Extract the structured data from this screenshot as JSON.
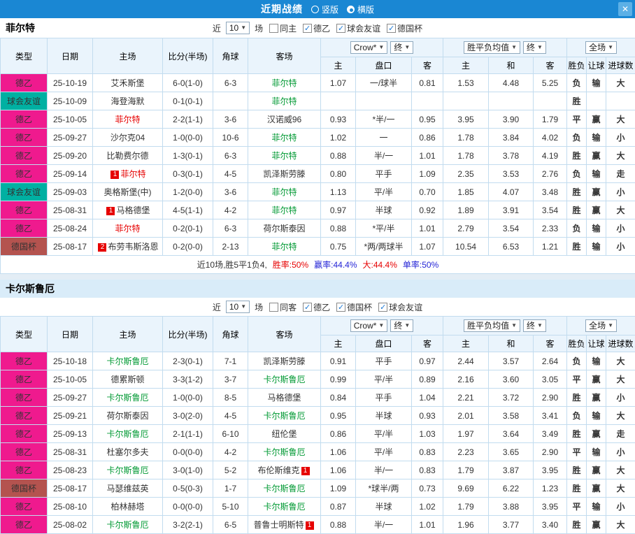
{
  "titlebar": {
    "title": "近期战绩",
    "layout_options": [
      {
        "label": "竖版",
        "selected": false
      },
      {
        "label": "横版",
        "selected": true
      }
    ],
    "close_icon": "✕"
  },
  "table_header": {
    "fixed_columns": [
      "类型",
      "日期",
      "主场",
      "比分(半场)",
      "角球",
      "客场"
    ],
    "odds_dropdowns": [
      "Crow*",
      "终"
    ],
    "avg_dropdowns": [
      "胜平负均值",
      "终"
    ],
    "scope_dropdown": "全场",
    "sub_columns": [
      "主",
      "盘口",
      "客",
      "主",
      "和",
      "客",
      "胜负",
      "让球",
      "进球数"
    ]
  },
  "colors": {
    "accent": "#1a87d3",
    "type_德乙": "#ef1a8e",
    "type_球会友谊": "#00b0a2",
    "type_德国杯": "#b4534f",
    "red": "#e60000",
    "green": "#009933",
    "blue": "#2424d6"
  },
  "sections": [
    {
      "team": "菲尔特",
      "head_style": "inline",
      "filter": {
        "prefix": "近",
        "count": "10",
        "suffix": "场",
        "checkboxes": [
          {
            "label": "同主",
            "checked": false
          },
          {
            "label": "德乙",
            "checked": true
          },
          {
            "label": "球会友谊",
            "checked": true
          },
          {
            "label": "德国杯",
            "checked": true
          }
        ]
      },
      "rows": [
        {
          "type": "德乙",
          "date": "25-10-19",
          "home": {
            "name": "艾禾斯堡",
            "color": "black"
          },
          "score": "6-0(1-0)",
          "corners": "6-3",
          "away": {
            "name": "菲尔特",
            "color": "green"
          },
          "odds": [
            "1.07",
            "一/球半",
            "0.81"
          ],
          "avg": [
            "1.53",
            "4.48",
            "5.25"
          ],
          "result": {
            "text": "负",
            "color": "green"
          },
          "handicap_result": {
            "text": "输",
            "color": "green"
          },
          "goals": {
            "text": "大",
            "color": "red"
          }
        },
        {
          "type": "球会友谊",
          "date": "25-10-09",
          "home": {
            "name": "海登海默",
            "color": "black"
          },
          "score": "0-1(0-1)",
          "corners": "",
          "away": {
            "name": "菲尔特",
            "color": "green"
          },
          "odds": [
            "",
            "",
            ""
          ],
          "avg": [
            "",
            "",
            ""
          ],
          "result": {
            "text": "胜",
            "color": "red"
          },
          "handicap_result": {
            "text": "",
            "color": "black"
          },
          "goals": {
            "text": "",
            "color": "black"
          }
        },
        {
          "type": "德乙",
          "date": "25-10-05",
          "home": {
            "name": "菲尔特",
            "color": "red"
          },
          "score": "2-2(1-1)",
          "corners": "3-6",
          "away": {
            "name": "汉诺威96",
            "color": "black"
          },
          "odds": [
            "0.93",
            "*半/一",
            "0.95"
          ],
          "avg": [
            "3.95",
            "3.90",
            "1.79"
          ],
          "result": {
            "text": "平",
            "color": "blue"
          },
          "handicap_result": {
            "text": "赢",
            "color": "red"
          },
          "goals": {
            "text": "大",
            "color": "red"
          }
        },
        {
          "type": "德乙",
          "date": "25-09-27",
          "home": {
            "name": "沙尔克04",
            "color": "black"
          },
          "score": "1-0(0-0)",
          "corners": "10-6",
          "away": {
            "name": "菲尔特",
            "color": "green"
          },
          "odds": [
            "1.02",
            "一",
            "0.86"
          ],
          "avg": [
            "1.78",
            "3.84",
            "4.02"
          ],
          "result": {
            "text": "负",
            "color": "green"
          },
          "handicap_result": {
            "text": "输",
            "color": "green"
          },
          "goals": {
            "text": "小",
            "color": "green"
          }
        },
        {
          "type": "德乙",
          "date": "25-09-20",
          "home": {
            "name": "比勒费尔德",
            "color": "black"
          },
          "score": "1-3(0-1)",
          "corners": "6-3",
          "away": {
            "name": "菲尔特",
            "color": "green"
          },
          "odds": [
            "0.88",
            "半/一",
            "1.01"
          ],
          "avg": [
            "1.78",
            "3.78",
            "4.19"
          ],
          "result": {
            "text": "胜",
            "color": "red"
          },
          "handicap_result": {
            "text": "赢",
            "color": "red"
          },
          "goals": {
            "text": "大",
            "color": "red"
          }
        },
        {
          "type": "德乙",
          "date": "25-09-14",
          "home": {
            "name": "菲尔特",
            "color": "red",
            "badge": "1",
            "badge_pos": "before"
          },
          "score": "0-3(0-1)",
          "corners": "4-5",
          "away": {
            "name": "凯泽斯劳滕",
            "color": "black"
          },
          "odds": [
            "0.80",
            "平手",
            "1.09"
          ],
          "avg": [
            "2.35",
            "3.53",
            "2.76"
          ],
          "result": {
            "text": "负",
            "color": "green"
          },
          "handicap_result": {
            "text": "输",
            "color": "green"
          },
          "goals": {
            "text": "走",
            "color": "blue"
          }
        },
        {
          "type": "球会友谊",
          "date": "25-09-03",
          "home": {
            "name": "奥格斯堡(中)",
            "color": "black"
          },
          "score": "1-2(0-0)",
          "corners": "3-6",
          "away": {
            "name": "菲尔特",
            "color": "green"
          },
          "odds": [
            "1.13",
            "平/半",
            "0.70"
          ],
          "avg": [
            "1.85",
            "4.07",
            "3.48"
          ],
          "result": {
            "text": "胜",
            "color": "red"
          },
          "handicap_result": {
            "text": "赢",
            "color": "red"
          },
          "goals": {
            "text": "小",
            "color": "green"
          }
        },
        {
          "type": "德乙",
          "date": "25-08-31",
          "home": {
            "name": "马格德堡",
            "color": "black",
            "badge": "1",
            "badge_pos": "before"
          },
          "score": "4-5(1-1)",
          "corners": "4-2",
          "away": {
            "name": "菲尔特",
            "color": "green"
          },
          "odds": [
            "0.97",
            "半球",
            "0.92"
          ],
          "avg": [
            "1.89",
            "3.91",
            "3.54"
          ],
          "result": {
            "text": "胜",
            "color": "red"
          },
          "handicap_result": {
            "text": "赢",
            "color": "red"
          },
          "goals": {
            "text": "大",
            "color": "red"
          }
        },
        {
          "type": "德乙",
          "date": "25-08-24",
          "home": {
            "name": "菲尔特",
            "color": "red"
          },
          "score": "0-2(0-1)",
          "corners": "6-3",
          "away": {
            "name": "荷尔斯泰因",
            "color": "black"
          },
          "odds": [
            "0.88",
            "*平/半",
            "1.01"
          ],
          "avg": [
            "2.79",
            "3.54",
            "2.33"
          ],
          "result": {
            "text": "负",
            "color": "green"
          },
          "handicap_result": {
            "text": "输",
            "color": "green"
          },
          "goals": {
            "text": "小",
            "color": "green"
          }
        },
        {
          "type": "德国杯",
          "date": "25-08-17",
          "home": {
            "name": "布劳韦斯洛恩",
            "color": "black",
            "badge": "2",
            "badge_pos": "before"
          },
          "score": "0-2(0-0)",
          "corners": "2-13",
          "away": {
            "name": "菲尔特",
            "color": "green"
          },
          "odds": [
            "0.75",
            "*两/两球半",
            "1.07"
          ],
          "avg": [
            "10.54",
            "6.53",
            "1.21"
          ],
          "result": {
            "text": "胜",
            "color": "red"
          },
          "handicap_result": {
            "text": "输",
            "color": "green"
          },
          "goals": {
            "text": "小",
            "color": "green"
          }
        }
      ],
      "summary": [
        {
          "text": "近10场,胜5平1负4,",
          "color": "black"
        },
        {
          "text": "胜率:50%",
          "color": "red"
        },
        {
          "text": "赢率:44.4%",
          "color": "blue"
        },
        {
          "text": "大:44.4%",
          "color": "red"
        },
        {
          "text": "单率:50%",
          "color": "blue"
        }
      ]
    },
    {
      "team": "卡尔斯鲁厄",
      "head_style": "stacked",
      "filter": {
        "prefix": "近",
        "count": "10",
        "suffix": "场",
        "checkboxes": [
          {
            "label": "同客",
            "checked": false
          },
          {
            "label": "德乙",
            "checked": true
          },
          {
            "label": "德国杯",
            "checked": true
          },
          {
            "label": "球会友谊",
            "checked": true
          }
        ]
      },
      "rows": [
        {
          "type": "德乙",
          "date": "25-10-18",
          "home": {
            "name": "卡尔斯鲁厄",
            "color": "green"
          },
          "score": "2-3(0-1)",
          "corners": "7-1",
          "away": {
            "name": "凯泽斯劳滕",
            "color": "black"
          },
          "odds": [
            "0.91",
            "平手",
            "0.97"
          ],
          "avg": [
            "2.44",
            "3.57",
            "2.64"
          ],
          "result": {
            "text": "负",
            "color": "green"
          },
          "handicap_result": {
            "text": "输",
            "color": "green"
          },
          "goals": {
            "text": "大",
            "color": "red"
          }
        },
        {
          "type": "德乙",
          "date": "25-10-05",
          "home": {
            "name": "德累斯顿",
            "color": "black"
          },
          "score": "3-3(1-2)",
          "corners": "3-7",
          "away": {
            "name": "卡尔斯鲁厄",
            "color": "green"
          },
          "odds": [
            "0.99",
            "平/半",
            "0.89"
          ],
          "avg": [
            "2.16",
            "3.60",
            "3.05"
          ],
          "result": {
            "text": "平",
            "color": "blue"
          },
          "handicap_result": {
            "text": "赢",
            "color": "red"
          },
          "goals": {
            "text": "大",
            "color": "red"
          }
        },
        {
          "type": "德乙",
          "date": "25-09-27",
          "home": {
            "name": "卡尔斯鲁厄",
            "color": "green"
          },
          "score": "1-0(0-0)",
          "corners": "8-5",
          "away": {
            "name": "马格德堡",
            "color": "black"
          },
          "odds": [
            "0.84",
            "平手",
            "1.04"
          ],
          "avg": [
            "2.21",
            "3.72",
            "2.90"
          ],
          "result": {
            "text": "胜",
            "color": "red"
          },
          "handicap_result": {
            "text": "赢",
            "color": "red"
          },
          "goals": {
            "text": "小",
            "color": "green"
          }
        },
        {
          "type": "德乙",
          "date": "25-09-21",
          "home": {
            "name": "荷尔斯泰因",
            "color": "black"
          },
          "score": "3-0(2-0)",
          "corners": "4-5",
          "away": {
            "name": "卡尔斯鲁厄",
            "color": "green"
          },
          "odds": [
            "0.95",
            "半球",
            "0.93"
          ],
          "avg": [
            "2.01",
            "3.58",
            "3.41"
          ],
          "result": {
            "text": "负",
            "color": "green"
          },
          "handicap_result": {
            "text": "输",
            "color": "green"
          },
          "goals": {
            "text": "大",
            "color": "red"
          }
        },
        {
          "type": "德乙",
          "date": "25-09-13",
          "home": {
            "name": "卡尔斯鲁厄",
            "color": "green"
          },
          "score": "2-1(1-1)",
          "corners": "6-10",
          "away": {
            "name": "纽伦堡",
            "color": "black"
          },
          "odds": [
            "0.86",
            "平/半",
            "1.03"
          ],
          "avg": [
            "1.97",
            "3.64",
            "3.49"
          ],
          "result": {
            "text": "胜",
            "color": "red"
          },
          "handicap_result": {
            "text": "赢",
            "color": "red"
          },
          "goals": {
            "text": "走",
            "color": "blue"
          }
        },
        {
          "type": "德乙",
          "date": "25-08-31",
          "home": {
            "name": "杜塞尔多夫",
            "color": "black"
          },
          "score": "0-0(0-0)",
          "corners": "4-2",
          "away": {
            "name": "卡尔斯鲁厄",
            "color": "green"
          },
          "odds": [
            "1.06",
            "平/半",
            "0.83"
          ],
          "avg": [
            "2.23",
            "3.65",
            "2.90"
          ],
          "result": {
            "text": "平",
            "color": "blue"
          },
          "handicap_result": {
            "text": "输",
            "color": "green"
          },
          "goals": {
            "text": "小",
            "color": "green"
          }
        },
        {
          "type": "德乙",
          "date": "25-08-23",
          "home": {
            "name": "卡尔斯鲁厄",
            "color": "green"
          },
          "score": "3-0(1-0)",
          "corners": "5-2",
          "away": {
            "name": "布伦斯维克",
            "color": "black",
            "badge": "1",
            "badge_pos": "after"
          },
          "odds": [
            "1.06",
            "半/一",
            "0.83"
          ],
          "avg": [
            "1.79",
            "3.87",
            "3.95"
          ],
          "result": {
            "text": "胜",
            "color": "red"
          },
          "handicap_result": {
            "text": "赢",
            "color": "red"
          },
          "goals": {
            "text": "大",
            "color": "red"
          }
        },
        {
          "type": "德国杯",
          "date": "25-08-17",
          "home": {
            "name": "马瑟维兹英",
            "color": "black"
          },
          "score": "0-5(0-3)",
          "corners": "1-7",
          "away": {
            "name": "卡尔斯鲁厄",
            "color": "green"
          },
          "odds": [
            "1.09",
            "*球半/两",
            "0.73"
          ],
          "avg": [
            "9.69",
            "6.22",
            "1.23"
          ],
          "result": {
            "text": "胜",
            "color": "red"
          },
          "handicap_result": {
            "text": "赢",
            "color": "red"
          },
          "goals": {
            "text": "大",
            "color": "red"
          }
        },
        {
          "type": "德乙",
          "date": "25-08-10",
          "home": {
            "name": "柏林赫塔",
            "color": "black"
          },
          "score": "0-0(0-0)",
          "corners": "5-10",
          "away": {
            "name": "卡尔斯鲁厄",
            "color": "green"
          },
          "odds": [
            "0.87",
            "半球",
            "1.02"
          ],
          "avg": [
            "1.79",
            "3.88",
            "3.95"
          ],
          "result": {
            "text": "平",
            "color": "blue"
          },
          "handicap_result": {
            "text": "输",
            "color": "green"
          },
          "goals": {
            "text": "小",
            "color": "green"
          }
        },
        {
          "type": "德乙",
          "date": "25-08-02",
          "home": {
            "name": "卡尔斯鲁厄",
            "color": "green"
          },
          "score": "3-2(2-1)",
          "corners": "6-5",
          "away": {
            "name": "普鲁士明斯特",
            "color": "black",
            "badge": "1",
            "badge_pos": "after"
          },
          "odds": [
            "0.88",
            "半/一",
            "1.01"
          ],
          "avg": [
            "1.96",
            "3.77",
            "3.40"
          ],
          "result": {
            "text": "胜",
            "color": "red"
          },
          "handicap_result": {
            "text": "赢",
            "color": "red"
          },
          "goals": {
            "text": "大",
            "color": "red"
          }
        }
      ],
      "summary": null
    }
  ]
}
